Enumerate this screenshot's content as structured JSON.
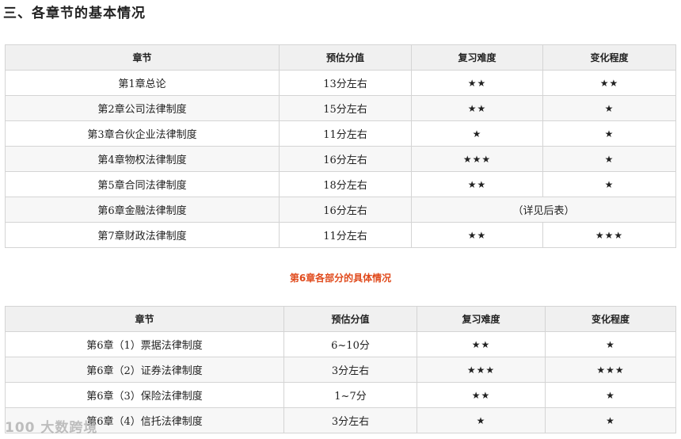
{
  "title": "三、各章节的基本情况",
  "table1": {
    "headers": [
      "章节",
      "预估分值",
      "复习难度",
      "变化程度"
    ],
    "rows": [
      {
        "chapter": "第1章总论",
        "score": "13分左右",
        "difficulty": "★★",
        "change": "★★"
      },
      {
        "chapter": "第2章公司法律制度",
        "score": "15分左右",
        "difficulty": "★★",
        "change": "★"
      },
      {
        "chapter": "第3章合伙企业法律制度",
        "score": "11分左右",
        "difficulty": "★",
        "change": "★"
      },
      {
        "chapter": "第4章物权法律制度",
        "score": "16分左右",
        "difficulty": "★★★",
        "change": "★"
      },
      {
        "chapter": "第5章合同法律制度",
        "score": "18分左右",
        "difficulty": "★★",
        "change": "★"
      },
      {
        "chapter": "第6章金融法律制度",
        "score": "16分左右",
        "merged_note": "（详见后表）"
      },
      {
        "chapter": "第7章财政法律制度",
        "score": "11分左右",
        "difficulty": "★★",
        "change": "★★★"
      }
    ]
  },
  "caption": "第6章各部分的具体情况",
  "table2": {
    "headers": [
      "章节",
      "预估分值",
      "复习难度",
      "变化程度"
    ],
    "rows": [
      {
        "chapter": "第6章（1）票据法律制度",
        "score": "6~10分",
        "difficulty": "★★",
        "change": "★"
      },
      {
        "chapter": "第6章（2）证券法律制度",
        "score": "3分左右",
        "difficulty": "★★★",
        "change": "★★★"
      },
      {
        "chapter": "第6章（3）保险法律制度",
        "score": "1~7分",
        "difficulty": "★★",
        "change": "★"
      },
      {
        "chapter": "第6章（4）信托法律制度",
        "score": "3分左右",
        "difficulty": "★",
        "change": "★"
      }
    ]
  },
  "watermark": "100 大数跨境"
}
